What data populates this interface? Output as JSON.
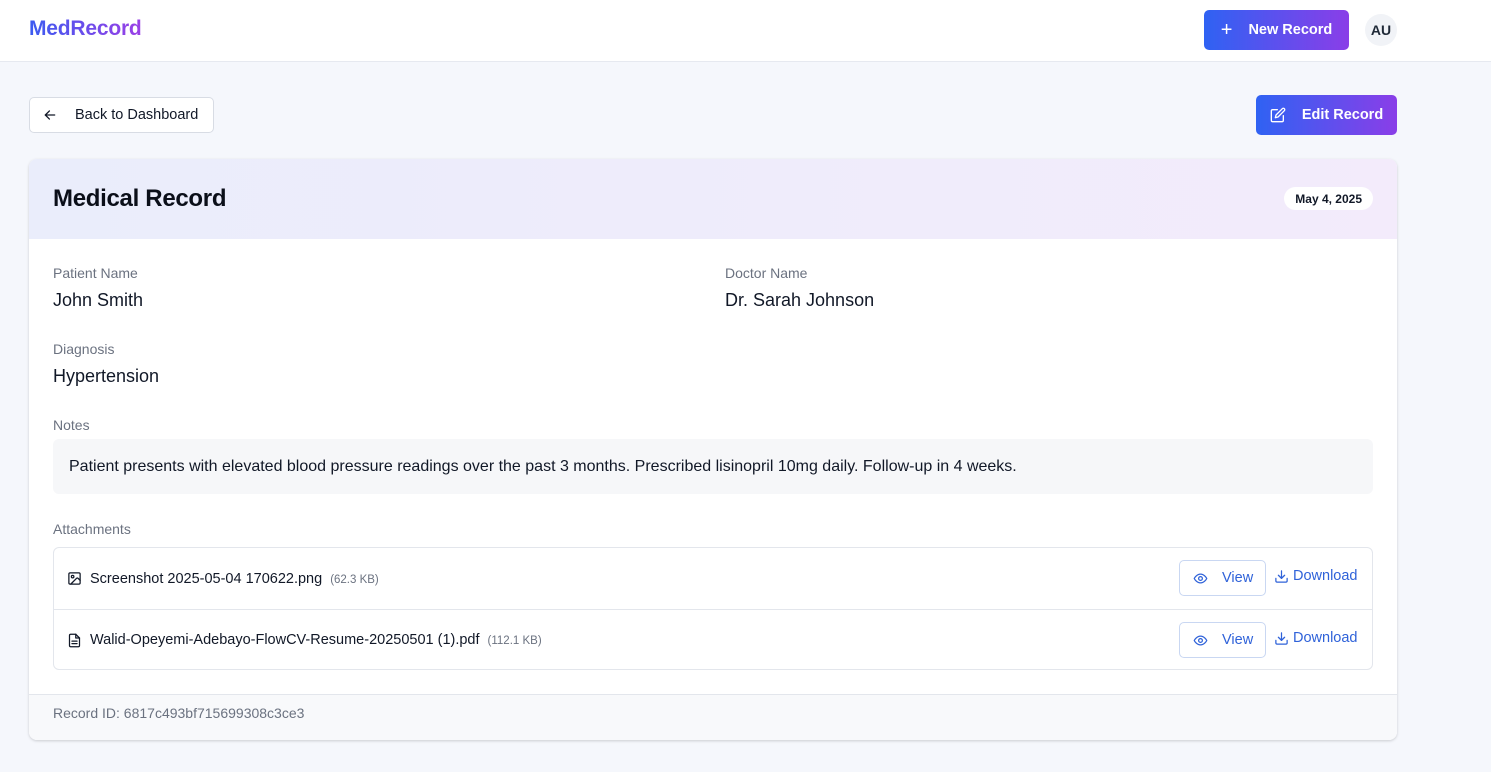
{
  "app": {
    "brand": "MedRecord",
    "new_record_label": "New Record",
    "user_initials": "AU"
  },
  "toolbar": {
    "back_label": "Back to Dashboard",
    "edit_label": "Edit Record"
  },
  "record": {
    "title": "Medical Record",
    "date": "May 4, 2025",
    "patient_label": "Patient Name",
    "patient_name": "John Smith",
    "doctor_label": "Doctor Name",
    "doctor_name": "Dr. Sarah Johnson",
    "diagnosis_label": "Diagnosis",
    "diagnosis": "Hypertension",
    "notes_label": "Notes",
    "notes": "Patient presents with elevated blood pressure readings over the past 3 months. Prescribed lisinopril 10mg daily. Follow-up in 4 weeks.",
    "attachments_label": "Attachments",
    "attachments": [
      {
        "name": "Screenshot 2025-05-04 170622.png",
        "size": "(62.3 KB)",
        "icon": "image-icon",
        "view_label": "View",
        "download_label": "Download"
      },
      {
        "name": "Walid-Opeyemi-Adebayo-FlowCV-Resume-20250501 (1).pdf",
        "size": "(112.1 KB)",
        "icon": "file-text-icon",
        "view_label": "View",
        "download_label": "Download"
      }
    ],
    "record_id_text": "Record ID: 6817c493bf715699308c3ce3"
  },
  "colors": {
    "accent_start": "#2f62f3",
    "accent_end": "#8a3ee8",
    "link": "#2f62d9"
  }
}
